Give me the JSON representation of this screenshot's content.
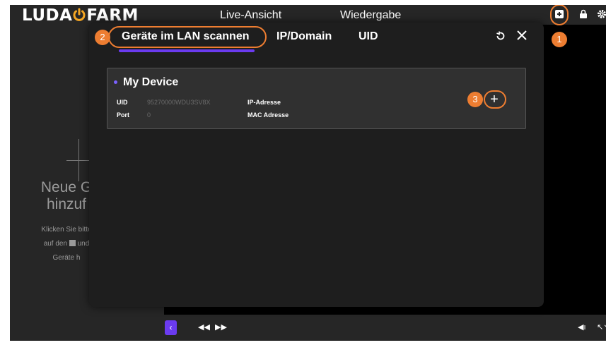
{
  "app": {
    "logo_left": "LUDA",
    "logo_right": "FARM",
    "nav_tabs": [
      "Live-Ansicht",
      "Wiedergabe"
    ]
  },
  "left_panel": {
    "neue_line1": "Neue G",
    "neue_line2": "hinzuf",
    "hint_line1": "Klicken Sie bitte",
    "hint_line2": "auf den",
    "hint_line2b": "und",
    "hint_line3": "Geräte h"
  },
  "dialog": {
    "tabs": [
      "Geräte im LAN scannen",
      "IP/Domain",
      "UID"
    ],
    "active_tab": "Geräte im LAN scannen",
    "device": {
      "name": "My Device",
      "uid_label": "UID",
      "uid_value": "95270000WDU3SV8X",
      "port_label": "Port",
      "port_value": "0",
      "ip_label": "IP-Adresse",
      "mac_label": "MAC Adresse"
    }
  },
  "annotations": {
    "step1": "1",
    "step2": "2",
    "step3": "3",
    "color": "#ed7d31"
  },
  "colors": {
    "accent": "#6b3bf0",
    "background": "#262626",
    "dialog_bg": "#1e1e1e"
  }
}
